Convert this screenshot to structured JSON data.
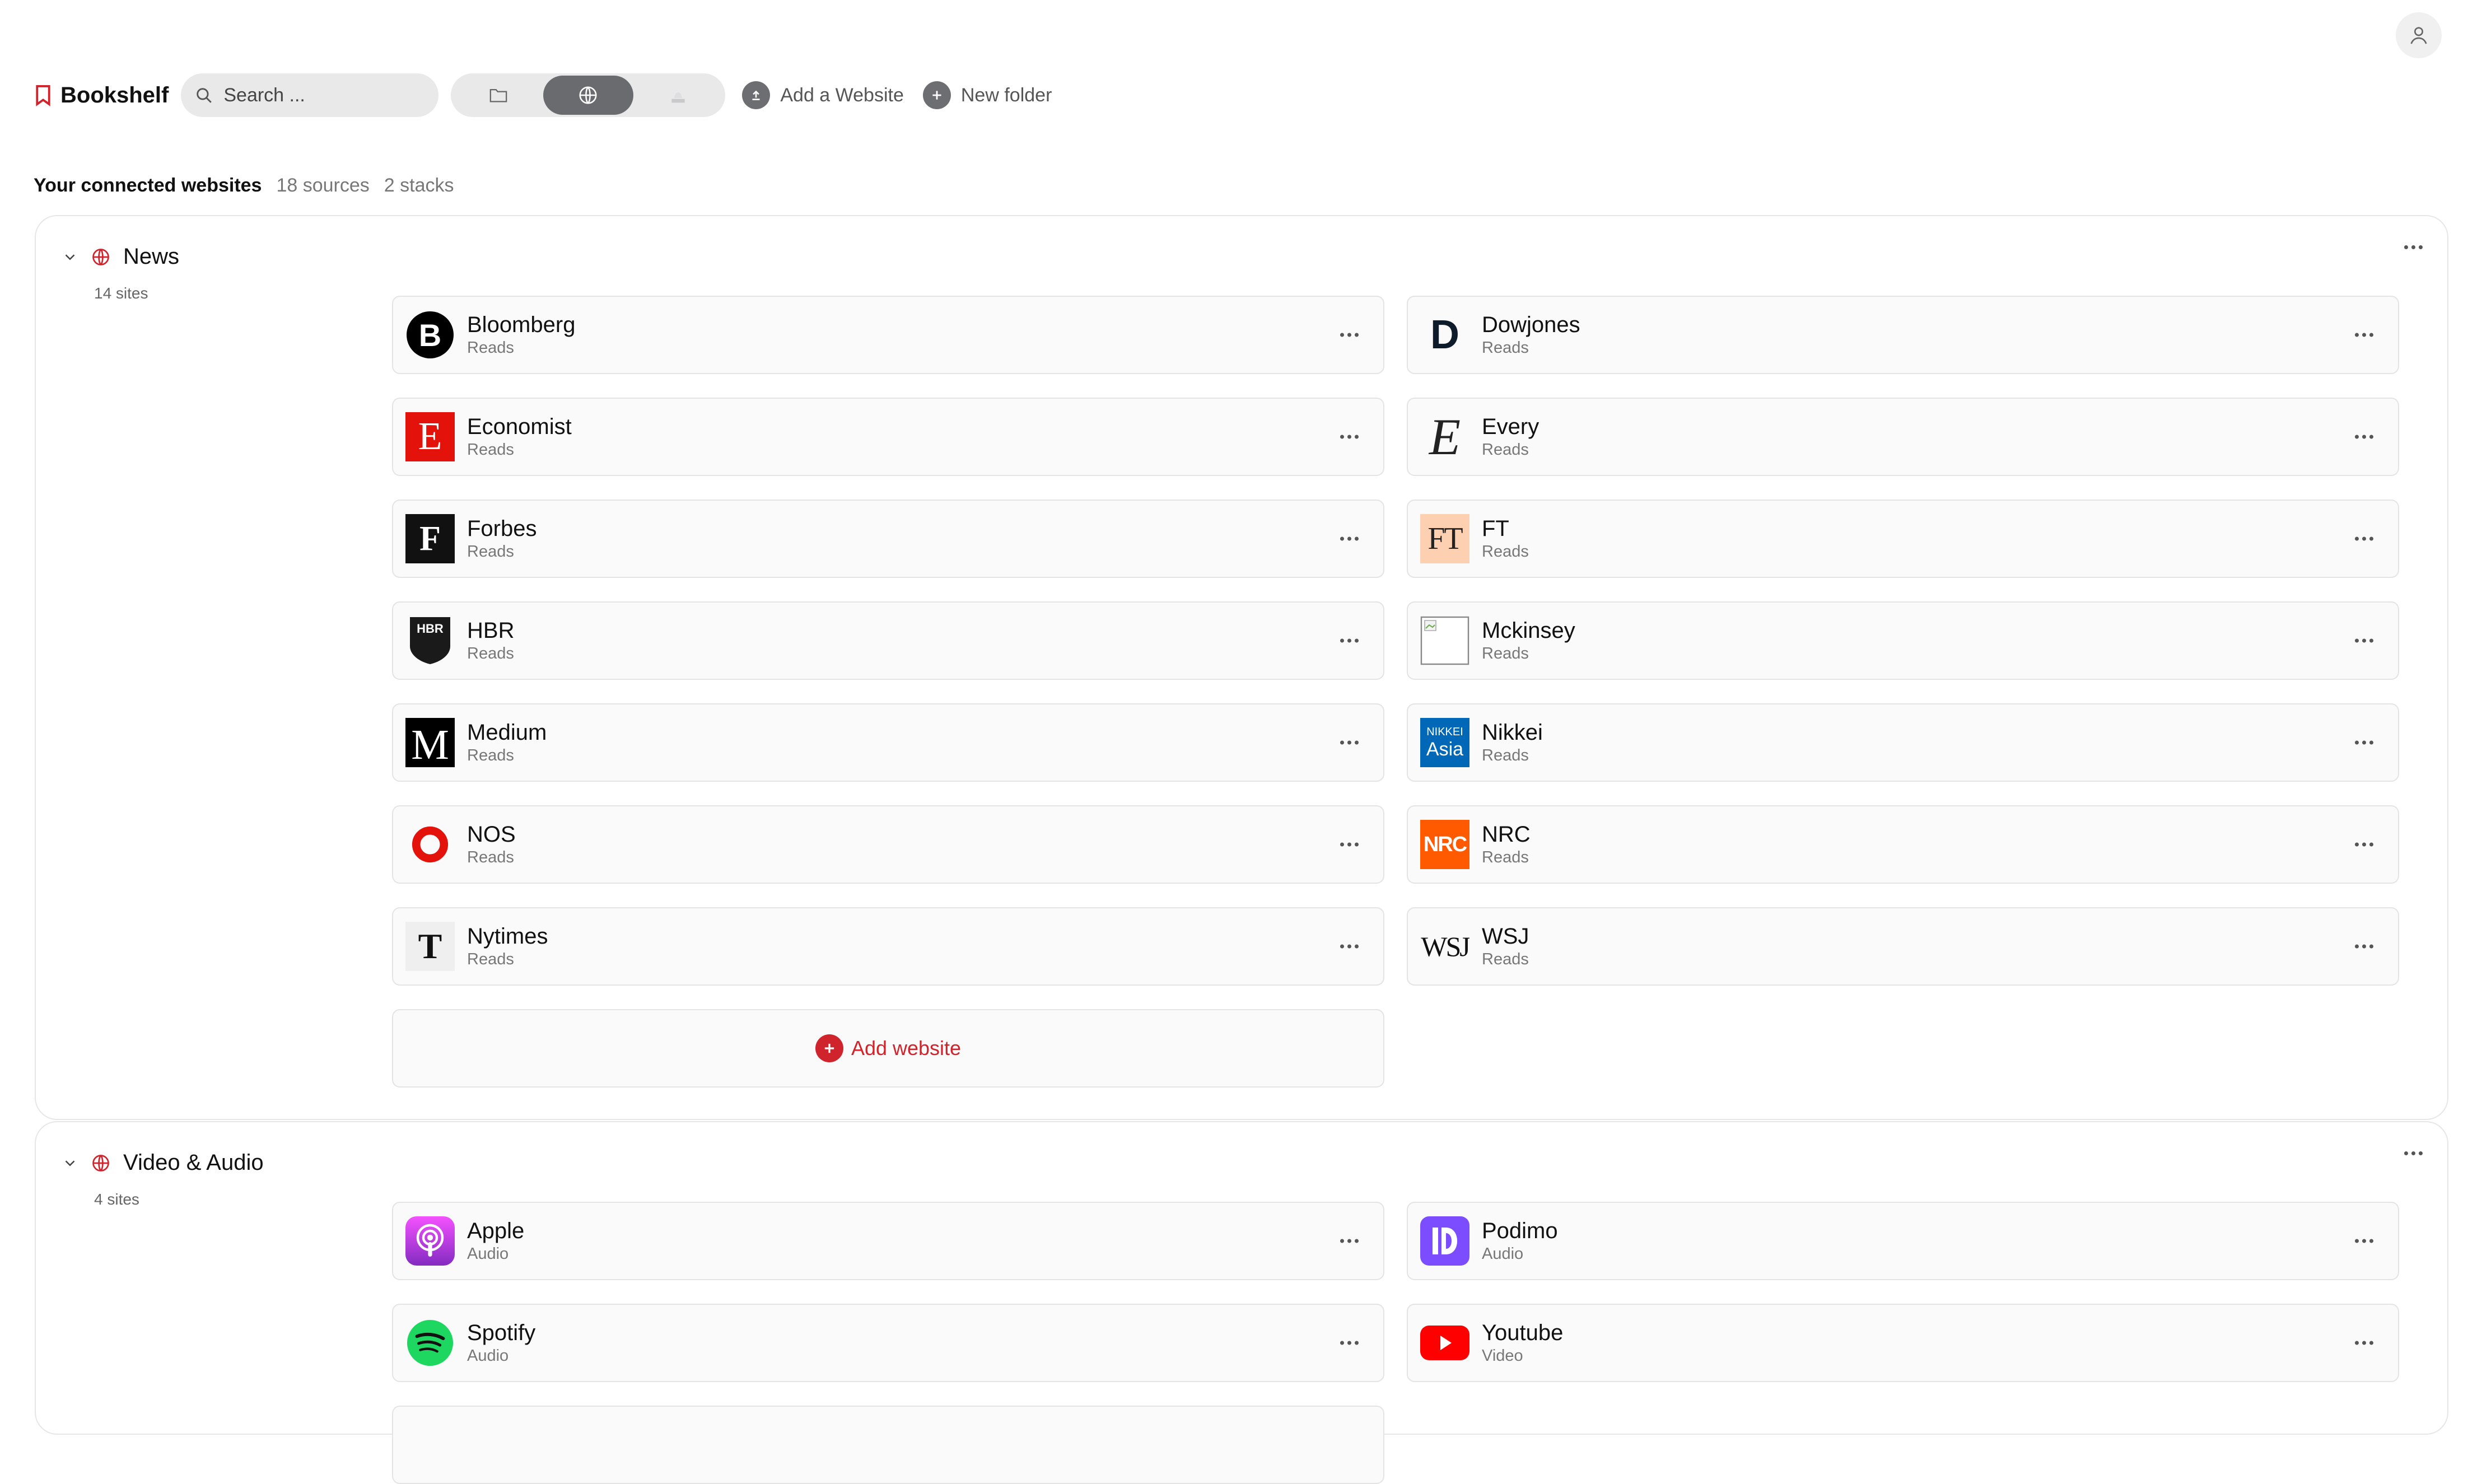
{
  "header": {
    "brand": "Bookshelf",
    "search_placeholder": "Search ...",
    "view_toggle": [
      "folder-view",
      "website-view",
      "stack-view"
    ],
    "add_website_label": "Add a Website",
    "new_folder_label": "New folder"
  },
  "summary": {
    "title": "Your connected websites",
    "sources": "18 sources",
    "stacks": "2 stacks"
  },
  "stacks": [
    {
      "name": "News",
      "count": "14 sites",
      "items": [
        {
          "name": "Bloomberg",
          "sub": "Reads"
        },
        {
          "name": "Dowjones",
          "sub": "Reads"
        },
        {
          "name": "Economist",
          "sub": "Reads"
        },
        {
          "name": "Every",
          "sub": "Reads"
        },
        {
          "name": "Forbes",
          "sub": "Reads"
        },
        {
          "name": "FT",
          "sub": "Reads"
        },
        {
          "name": "HBR",
          "sub": "Reads"
        },
        {
          "name": "Mckinsey",
          "sub": "Reads"
        },
        {
          "name": "Medium",
          "sub": "Reads"
        },
        {
          "name": "Nikkei",
          "sub": "Reads"
        },
        {
          "name": "NOS",
          "sub": "Reads"
        },
        {
          "name": "NRC",
          "sub": "Reads"
        },
        {
          "name": "Nytimes",
          "sub": "Reads"
        },
        {
          "name": "WSJ",
          "sub": "Reads"
        }
      ],
      "add_label": "Add website"
    },
    {
      "name": "Video & Audio",
      "count": "4 sites",
      "items": [
        {
          "name": "Apple",
          "sub": "Audio"
        },
        {
          "name": "Podimo",
          "sub": "Audio"
        },
        {
          "name": "Spotify",
          "sub": "Audio"
        },
        {
          "name": "Youtube",
          "sub": "Video"
        }
      ]
    }
  ],
  "logos": {
    "bloomberg": "B",
    "dowjones": "D",
    "economist": "E",
    "every": "E",
    "forbes": "F",
    "ft": "FT",
    "hbr": "HBR",
    "medium": "M",
    "nikkei_top": "NIKKEI",
    "nikkei_bottom": "Asia",
    "nrc": "NRC",
    "nytimes": "T",
    "wsj": "WSJ"
  },
  "colors": {
    "accent_red": "#d0242c",
    "economist_red": "#e3120b",
    "ft_salmon": "#fcd0b1",
    "nikkei_blue": "#0068b7",
    "nrc_orange": "#ff5a00",
    "spotify_green": "#1ed760",
    "youtube_red": "#ff0000",
    "podimo_purple": "#7c4dff",
    "apple_podcasts_purple": "#b150e2"
  }
}
